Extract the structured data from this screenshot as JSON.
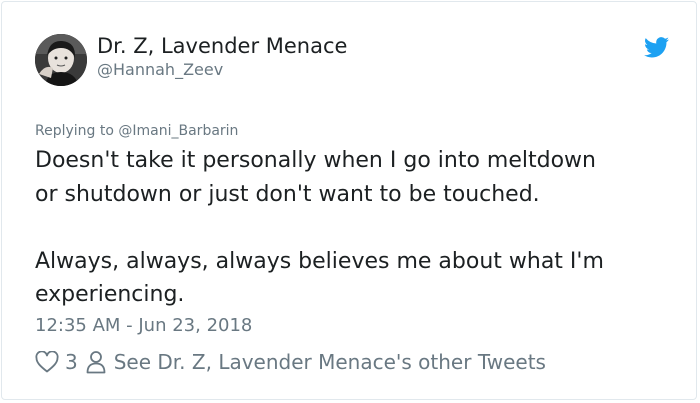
{
  "author": {
    "display_name": "Dr. Z, Lavender Menace",
    "handle": "@Hannah_Zeev",
    "avatar_icon": "profile-photo"
  },
  "brand": {
    "icon": "twitter-bird-icon",
    "color": "#1da1f2"
  },
  "tweet": {
    "reply_prefix": "Replying to",
    "reply_to": "@Imani_Barbarin",
    "lines": [
      "Doesn't take it personally when I go into meltdown",
      "or shutdown or just don't want to be touched.",
      "Always, always, always believes me about what I'm",
      "experiencing."
    ],
    "timestamp": "12:35 AM - Jun 23, 2018"
  },
  "actions": {
    "like_icon": "heart-icon",
    "like_count": "3",
    "profile_icon": "person-icon",
    "other_tweets_label": "See Dr. Z, Lavender Menace's other Tweets"
  },
  "colors": {
    "text": "#1c2022",
    "secondary": "#697882",
    "border": "#e1e8ed"
  }
}
